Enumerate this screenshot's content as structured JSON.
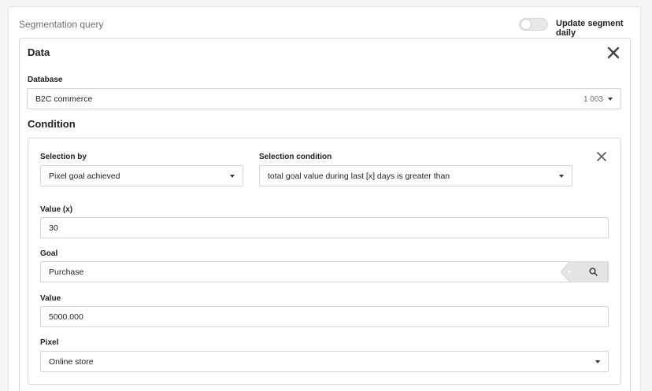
{
  "header": {
    "title": "Segmentation query",
    "toggle_label": "Update segment daily",
    "toggle_on": false
  },
  "data_panel": {
    "title": "Data",
    "database_label": "Database",
    "database_value": "B2C commerce",
    "database_count": "1 003"
  },
  "condition": {
    "title": "Condition",
    "selection_by_label": "Selection by",
    "selection_by_value": "Pixel goal achieved",
    "selection_condition_label": "Selection condition",
    "selection_condition_value": "total goal value during last [x] days is greater than",
    "value_x_label": "Value (x)",
    "value_x": "30",
    "goal_label": "Goal",
    "goal_value": "Purchase",
    "value_label": "Value",
    "value": "5000.000",
    "pixel_label": "Pixel",
    "pixel_value": "Online store"
  },
  "colors": {
    "border": "#d8d8db",
    "muted_text": "#6f6f73",
    "search_button_bg": "#e4e4e6"
  },
  "icons": {
    "close": "close-icon",
    "search": "search-icon",
    "dropdown": "caret-down-icon"
  }
}
